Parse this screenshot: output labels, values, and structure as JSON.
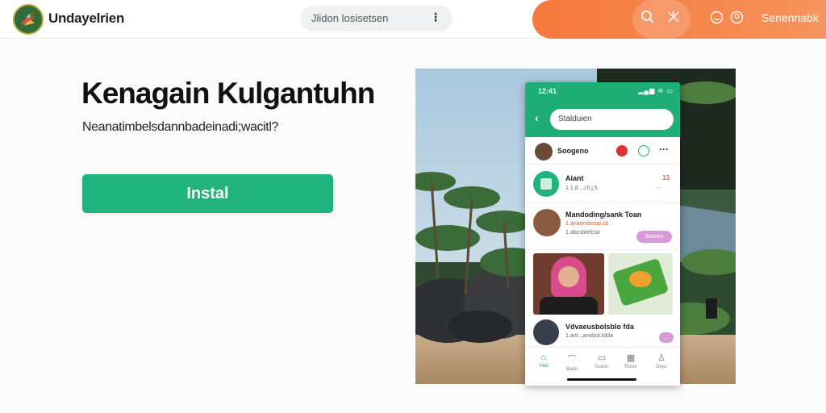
{
  "header": {
    "brand": "Undayelrien",
    "search_text": "Jlidon losisetsen",
    "menu_dots": "⋮",
    "signin_label": "Senennabk",
    "icons": [
      "search-icon",
      "close-icon",
      "smile-icon",
      "user-icon"
    ],
    "accent": "#f7793e"
  },
  "hero": {
    "title": "Kenagain Kulgantuhn",
    "subtitle": "Neanatimbelsdannbadeinadi;wacitl?",
    "install_label": "Instal",
    "accent": "#21b37d"
  },
  "phone": {
    "time": "12:41",
    "status": "▂▄▆ ≋ ▭",
    "search_text": "Stalduien",
    "profile_name": "Soogeno",
    "item1": {
      "title": "Aiant",
      "subtitle": "1.1.d ...l.lt.j.5",
      "count": "13",
      "badge": "..."
    },
    "item2": {
      "title": "Mandoding/sank Toan",
      "subtitle": "1.anatenbesai.sb",
      "detail": "1.abcsblefcso",
      "button": "Stalsen"
    },
    "item3": {
      "title": "Vdvaeusbolsblo fda",
      "subtitle": "1.ant...anobol.lobla",
      "button": "..."
    },
    "nav": [
      {
        "icon": "home-icon",
        "label": "Hod"
      },
      {
        "icon": "bell-icon",
        "label": "Bado"
      },
      {
        "icon": "chat-icon",
        "label": "Suaon"
      },
      {
        "icon": "grid-icon",
        "label": "Rosie"
      },
      {
        "icon": "person-icon",
        "label": "Deps"
      }
    ]
  }
}
